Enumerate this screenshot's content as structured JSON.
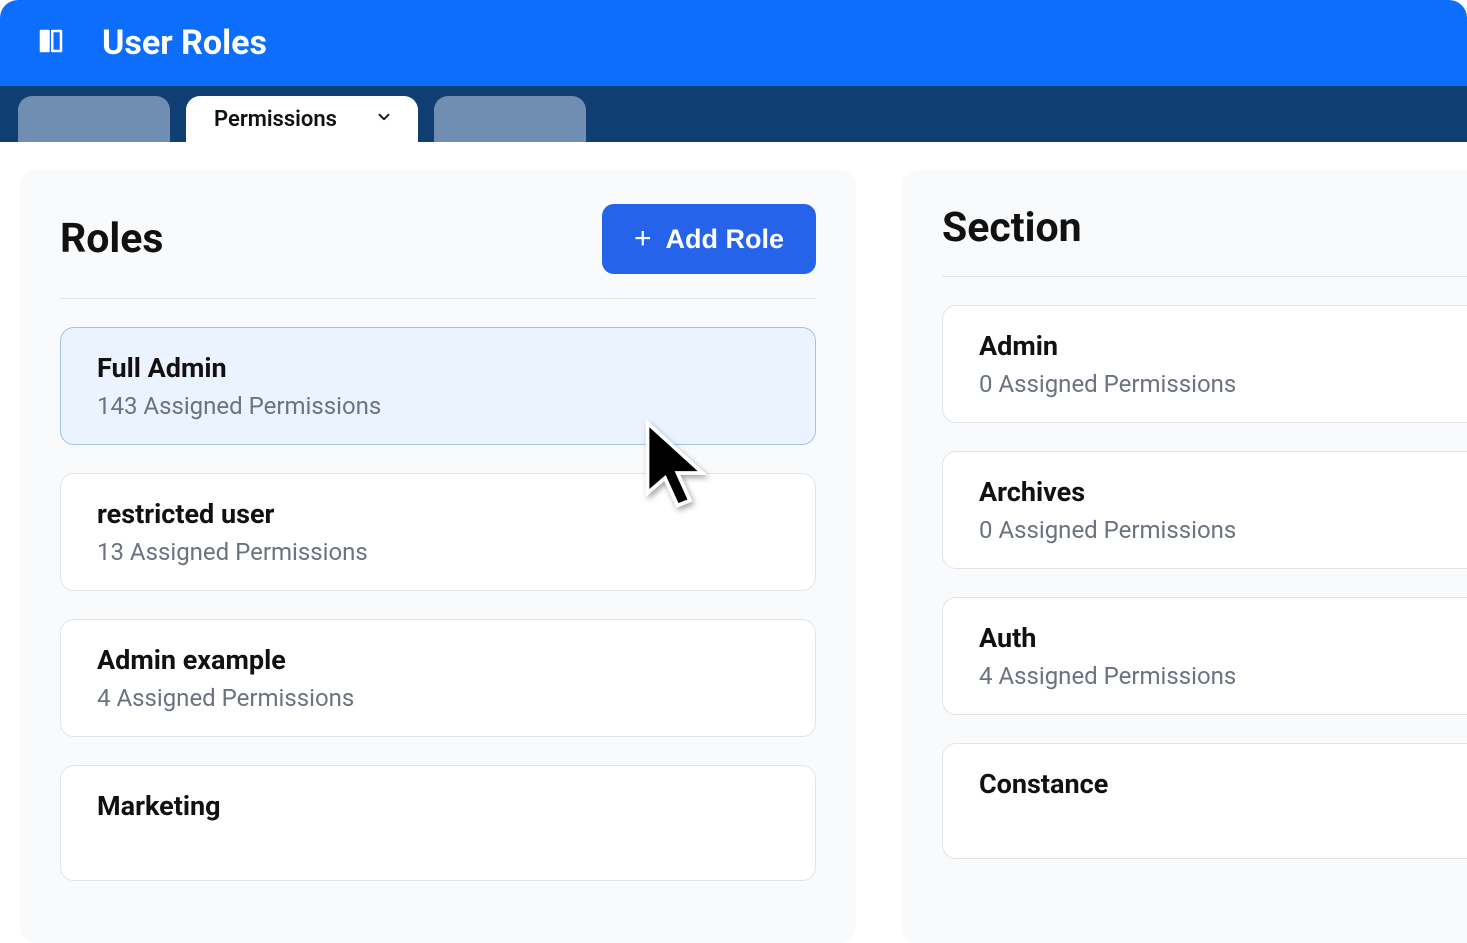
{
  "header": {
    "title": "User Roles"
  },
  "tabs": {
    "active_label": "Permissions"
  },
  "roles_panel": {
    "title": "Roles",
    "add_button_label": "Add Role",
    "items": [
      {
        "name": "Full Admin",
        "sub": "143 Assigned Permissions",
        "selected": true
      },
      {
        "name": "restricted user",
        "sub": "13 Assigned Permissions",
        "selected": false
      },
      {
        "name": "Admin example",
        "sub": "4 Assigned Permissions",
        "selected": false
      },
      {
        "name": "Marketing",
        "sub": "",
        "selected": false
      }
    ]
  },
  "section_panel": {
    "title": "Section",
    "items": [
      {
        "name": "Admin",
        "sub": "0 Assigned Permissions"
      },
      {
        "name": "Archives",
        "sub": "0 Assigned Permissions"
      },
      {
        "name": "Auth",
        "sub": "4 Assigned Permissions"
      },
      {
        "name": "Constance",
        "sub": ""
      }
    ]
  }
}
